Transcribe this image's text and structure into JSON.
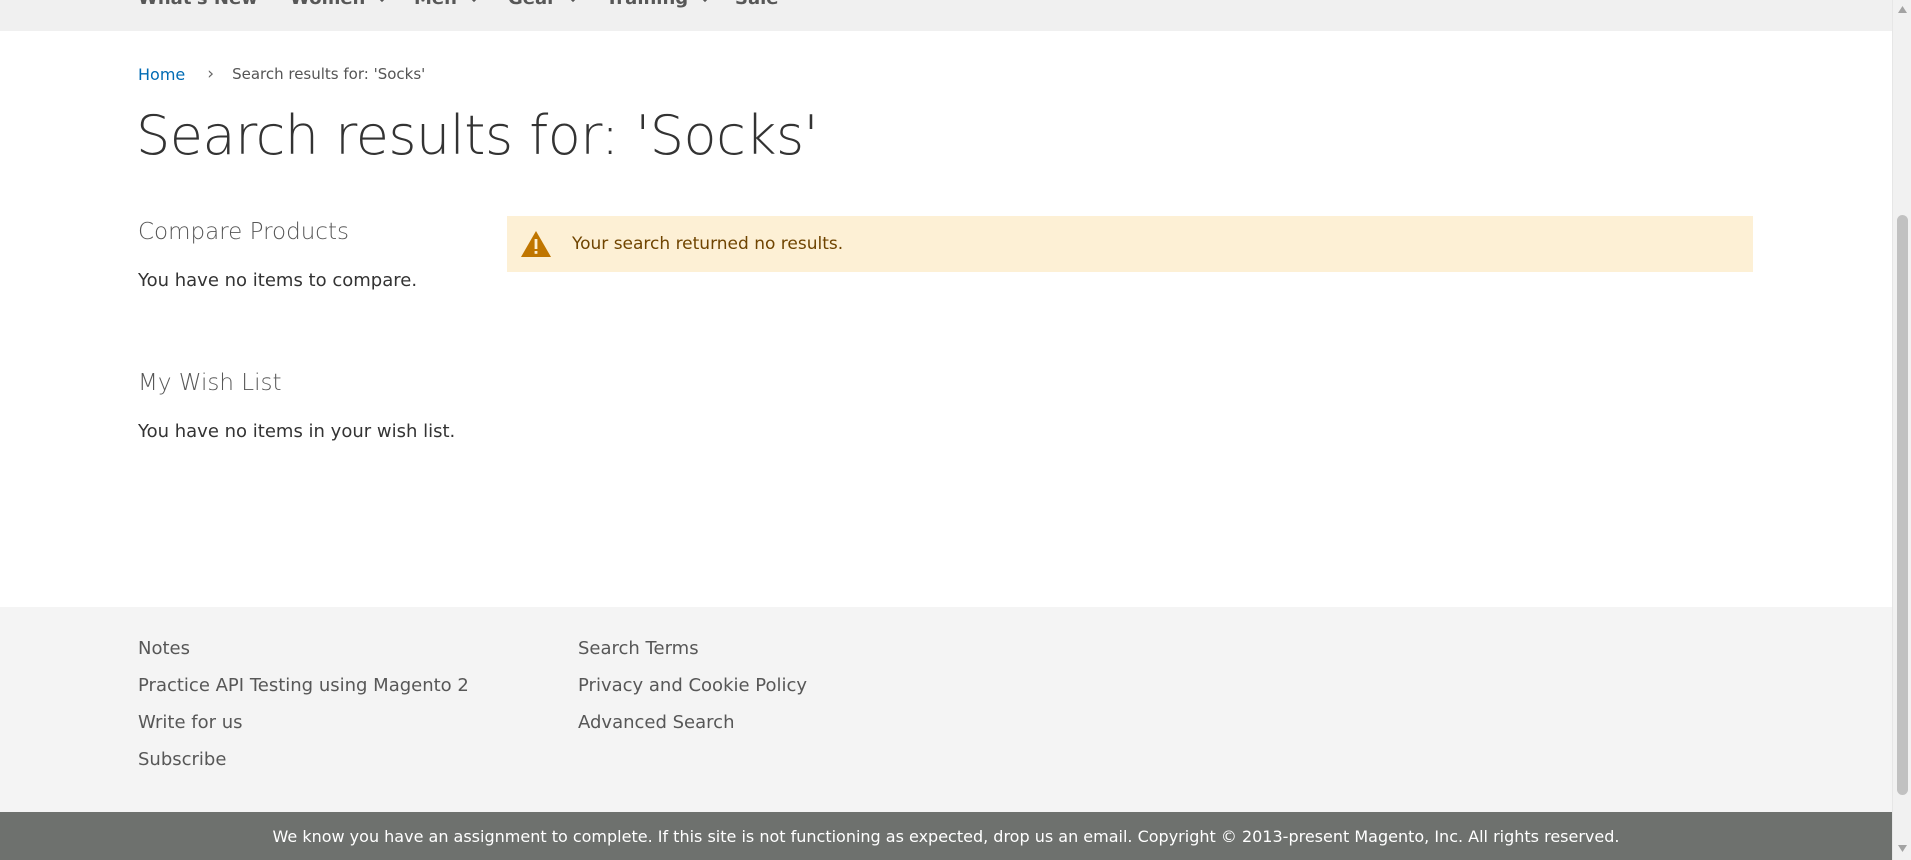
{
  "nav": {
    "items": [
      {
        "label": "What's New",
        "has_dropdown": false
      },
      {
        "label": "Women",
        "has_dropdown": true
      },
      {
        "label": "Men",
        "has_dropdown": true
      },
      {
        "label": "Gear",
        "has_dropdown": true
      },
      {
        "label": "Training",
        "has_dropdown": true
      },
      {
        "label": "Sale",
        "has_dropdown": false
      }
    ]
  },
  "breadcrumb": {
    "home": "Home",
    "separator": "›",
    "current": "Search results for: 'Socks'"
  },
  "page_title": "Search results for: 'Socks'",
  "sidebar": {
    "compare": {
      "title": "Compare Products",
      "text": "You have no items to compare."
    },
    "wishlist": {
      "title": "My Wish List",
      "text": "You have no items in your wish list."
    }
  },
  "notice": {
    "icon": "warning-icon",
    "message": "Your search returned no results."
  },
  "footer": {
    "col1": [
      "Notes",
      "Practice API Testing using Magento 2",
      "Write for us",
      "Subscribe"
    ],
    "col2": [
      "Search Terms",
      "Privacy and Cookie Policy",
      "Advanced Search"
    ]
  },
  "copyright": "We know you have an assignment to complete. If this site is not functioning as expected, drop us an email. Copyright © 2013-present Magento, Inc. All rights reserved.",
  "colors": {
    "link": "#006bb4",
    "notice_bg": "#fdf0d5",
    "warning": "#c07600",
    "footer_bg": "#f4f4f4",
    "copyright_bg": "#6e716e"
  }
}
